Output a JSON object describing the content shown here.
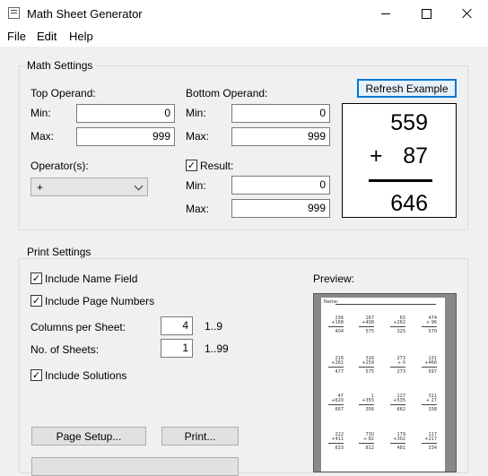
{
  "window": {
    "title": "Math Sheet Generator"
  },
  "menu": [
    "File",
    "Edit",
    "Help"
  ],
  "math_settings": {
    "group_title": "Math Settings",
    "top_operand": {
      "label": "Top Operand:",
      "min_label": "Min:",
      "min_value": "0",
      "max_label": "Max:",
      "max_value": "999"
    },
    "bottom_operand": {
      "label": "Bottom Operand:",
      "min_label": "Min:",
      "min_value": "0",
      "max_label": "Max:",
      "max_value": "999"
    },
    "operators_label": "Operator(s):",
    "operator_selected": "+",
    "result": {
      "label": "Result:",
      "checked": true,
      "min_label": "Min:",
      "min_value": "0",
      "max_label": "Max:",
      "max_value": "999"
    },
    "refresh_button": "Refresh Example",
    "example": {
      "top": "559",
      "operator": "+",
      "bottom": "87",
      "answer": "646"
    }
  },
  "print_settings": {
    "group_title": "Print Settings",
    "include_name_field": "Include Name Field",
    "include_page_numbers": "Include Page Numbers",
    "columns_label": "Columns per Sheet:",
    "columns_value": "4",
    "columns_range": "1..9",
    "sheets_label": "No. of Sheets:",
    "sheets_value": "1",
    "sheets_range": "1..99",
    "include_solutions": "Include Solutions",
    "page_setup_button": "Page Setup...",
    "print_button": "Print...",
    "preview_label": "Preview:",
    "preview_name_label": "Name:",
    "preview_problems": [
      [
        [
          "236",
          "+168",
          "404"
        ],
        [
          "167",
          "+408",
          "575"
        ],
        [
          "63",
          "+262",
          "325"
        ],
        [
          "474",
          "+ 96",
          "570"
        ]
      ],
      [
        [
          "216",
          "+261",
          "477"
        ],
        [
          "316",
          "+259",
          "575"
        ],
        [
          "273",
          "+  0",
          "273"
        ],
        [
          "131",
          "+466",
          "597"
        ]
      ],
      [
        [
          "47",
          "+620",
          "667"
        ],
        [
          "1",
          "+355",
          "356"
        ],
        [
          "127",
          "+535",
          "662"
        ],
        [
          "311",
          "+ 27",
          "338"
        ]
      ],
      [
        [
          "222",
          "+411",
          "633"
        ],
        [
          "730",
          "+ 82",
          "812"
        ],
        [
          "179",
          "+302",
          "481"
        ],
        [
          "117",
          "+217",
          "334"
        ]
      ]
    ]
  },
  "check_glyph": "✓"
}
